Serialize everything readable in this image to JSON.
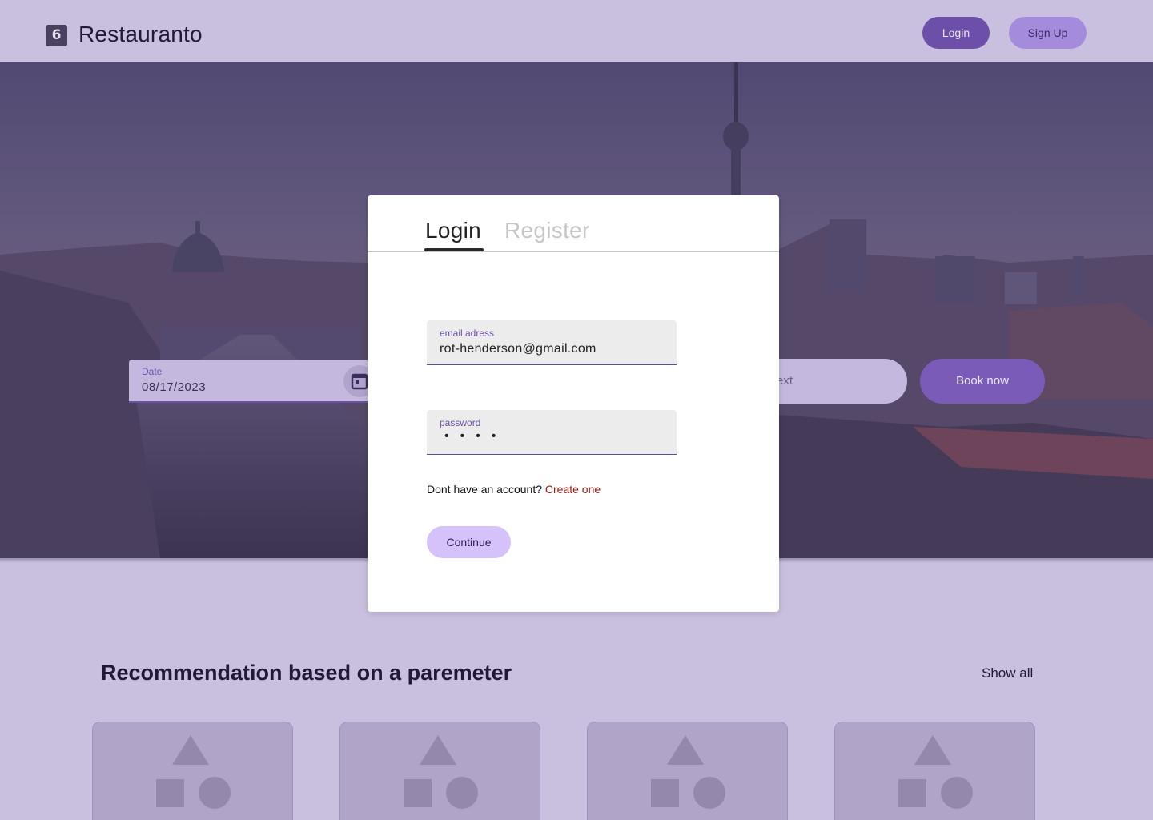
{
  "header": {
    "logo_glyph": "6",
    "brand": "Restauranto",
    "login_label": "Login",
    "signup_label": "Sign Up"
  },
  "booking": {
    "date_label": "Date",
    "date_value": "08/17/2023",
    "text_placeholder": "Text",
    "text_visible": "ext",
    "book_label": "Book now"
  },
  "modal": {
    "tabs": [
      {
        "label": "Login",
        "active": true
      },
      {
        "label": "Register",
        "active": false
      }
    ],
    "email_label": "email adress",
    "email_value": "rot-henderson@gmail.com",
    "password_label": "password",
    "password_mask": "••••",
    "account_prompt": "Dont have an account?",
    "create_link": "Create one",
    "continue_label": "Continue"
  },
  "recommendations": {
    "title": "Recommendation based on a paremeter",
    "show_all": "Show all",
    "cards": [
      {
        "icon": "placeholder-image-icon"
      },
      {
        "icon": "placeholder-image-icon"
      },
      {
        "icon": "placeholder-image-icon"
      },
      {
        "icon": "placeholder-image-icon"
      }
    ]
  },
  "colors": {
    "page_bg": "#c9bfdf",
    "primary": "#6b4fa8",
    "accent_light": "#d5c2fa",
    "link": "#9a1a10"
  }
}
